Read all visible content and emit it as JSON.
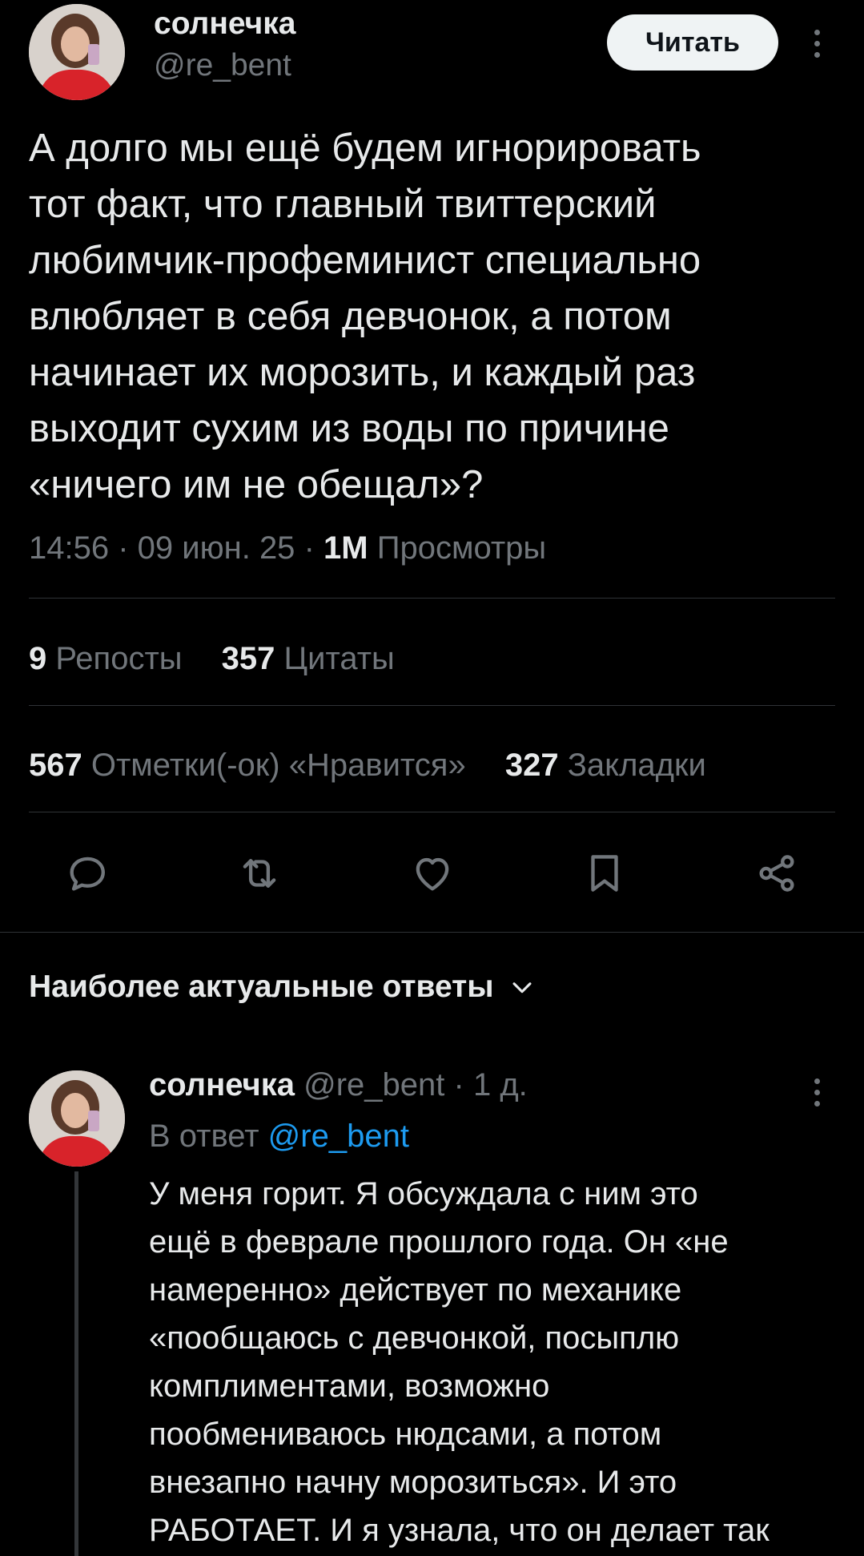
{
  "tweet": {
    "author_name": "солнечка",
    "author_handle": "@re_bent",
    "follow_label": "Читать",
    "text": "А долго мы ещё будем игнорировать\nтот факт, что главный твиттерский\nлюбимчик-профеминист специально\nвлюбляет в себя девчонок, а потом\nначинает их морозить, и каждый раз\nвыходит сухим из воды по причине\n«ничего им не обещал»?",
    "time": "14:56",
    "date": "09 июн. 25",
    "views_count": "1М",
    "views_label": "Просмотры"
  },
  "stats": {
    "reposts_count": "9",
    "reposts_label": "Репосты",
    "quotes_count": "357",
    "quotes_label": "Цитаты",
    "likes_count": "567",
    "likes_label": "Отметки(-ок) «Нравится»",
    "bookmarks_count": "327",
    "bookmarks_label": "Закладки"
  },
  "actions": {
    "icons": [
      "reply-icon",
      "retweet-icon",
      "like-icon",
      "bookmark-icon",
      "share-icon"
    ]
  },
  "replies_section": {
    "title": "Наиболее актуальные ответы"
  },
  "reply": {
    "author_name": "солнечка",
    "author_handle": "@re_bent",
    "time": "1 д.",
    "reply_to_label": "В ответ",
    "reply_to_mention": "@re_bent",
    "text": "У меня горит. Я обсуждала с ним это\nещё в феврале прошлого года. Он «не\nнамеренно» действует по механике\n«пообщаюсь с девчонкой, посыплю\nкомплиментами, возможно\nпообмениваюсь нюдсами, а потом\nвнезапно начну морозиться». И это\nРАБОТАЕТ. И я узнала, что он делает так"
  },
  "colors": {
    "background": "#000000",
    "text": "#e7e9ea",
    "secondary": "#71767b",
    "divider": "#2f3336",
    "accent": "#1d9bf0",
    "button_bg": "#eff3f4"
  }
}
